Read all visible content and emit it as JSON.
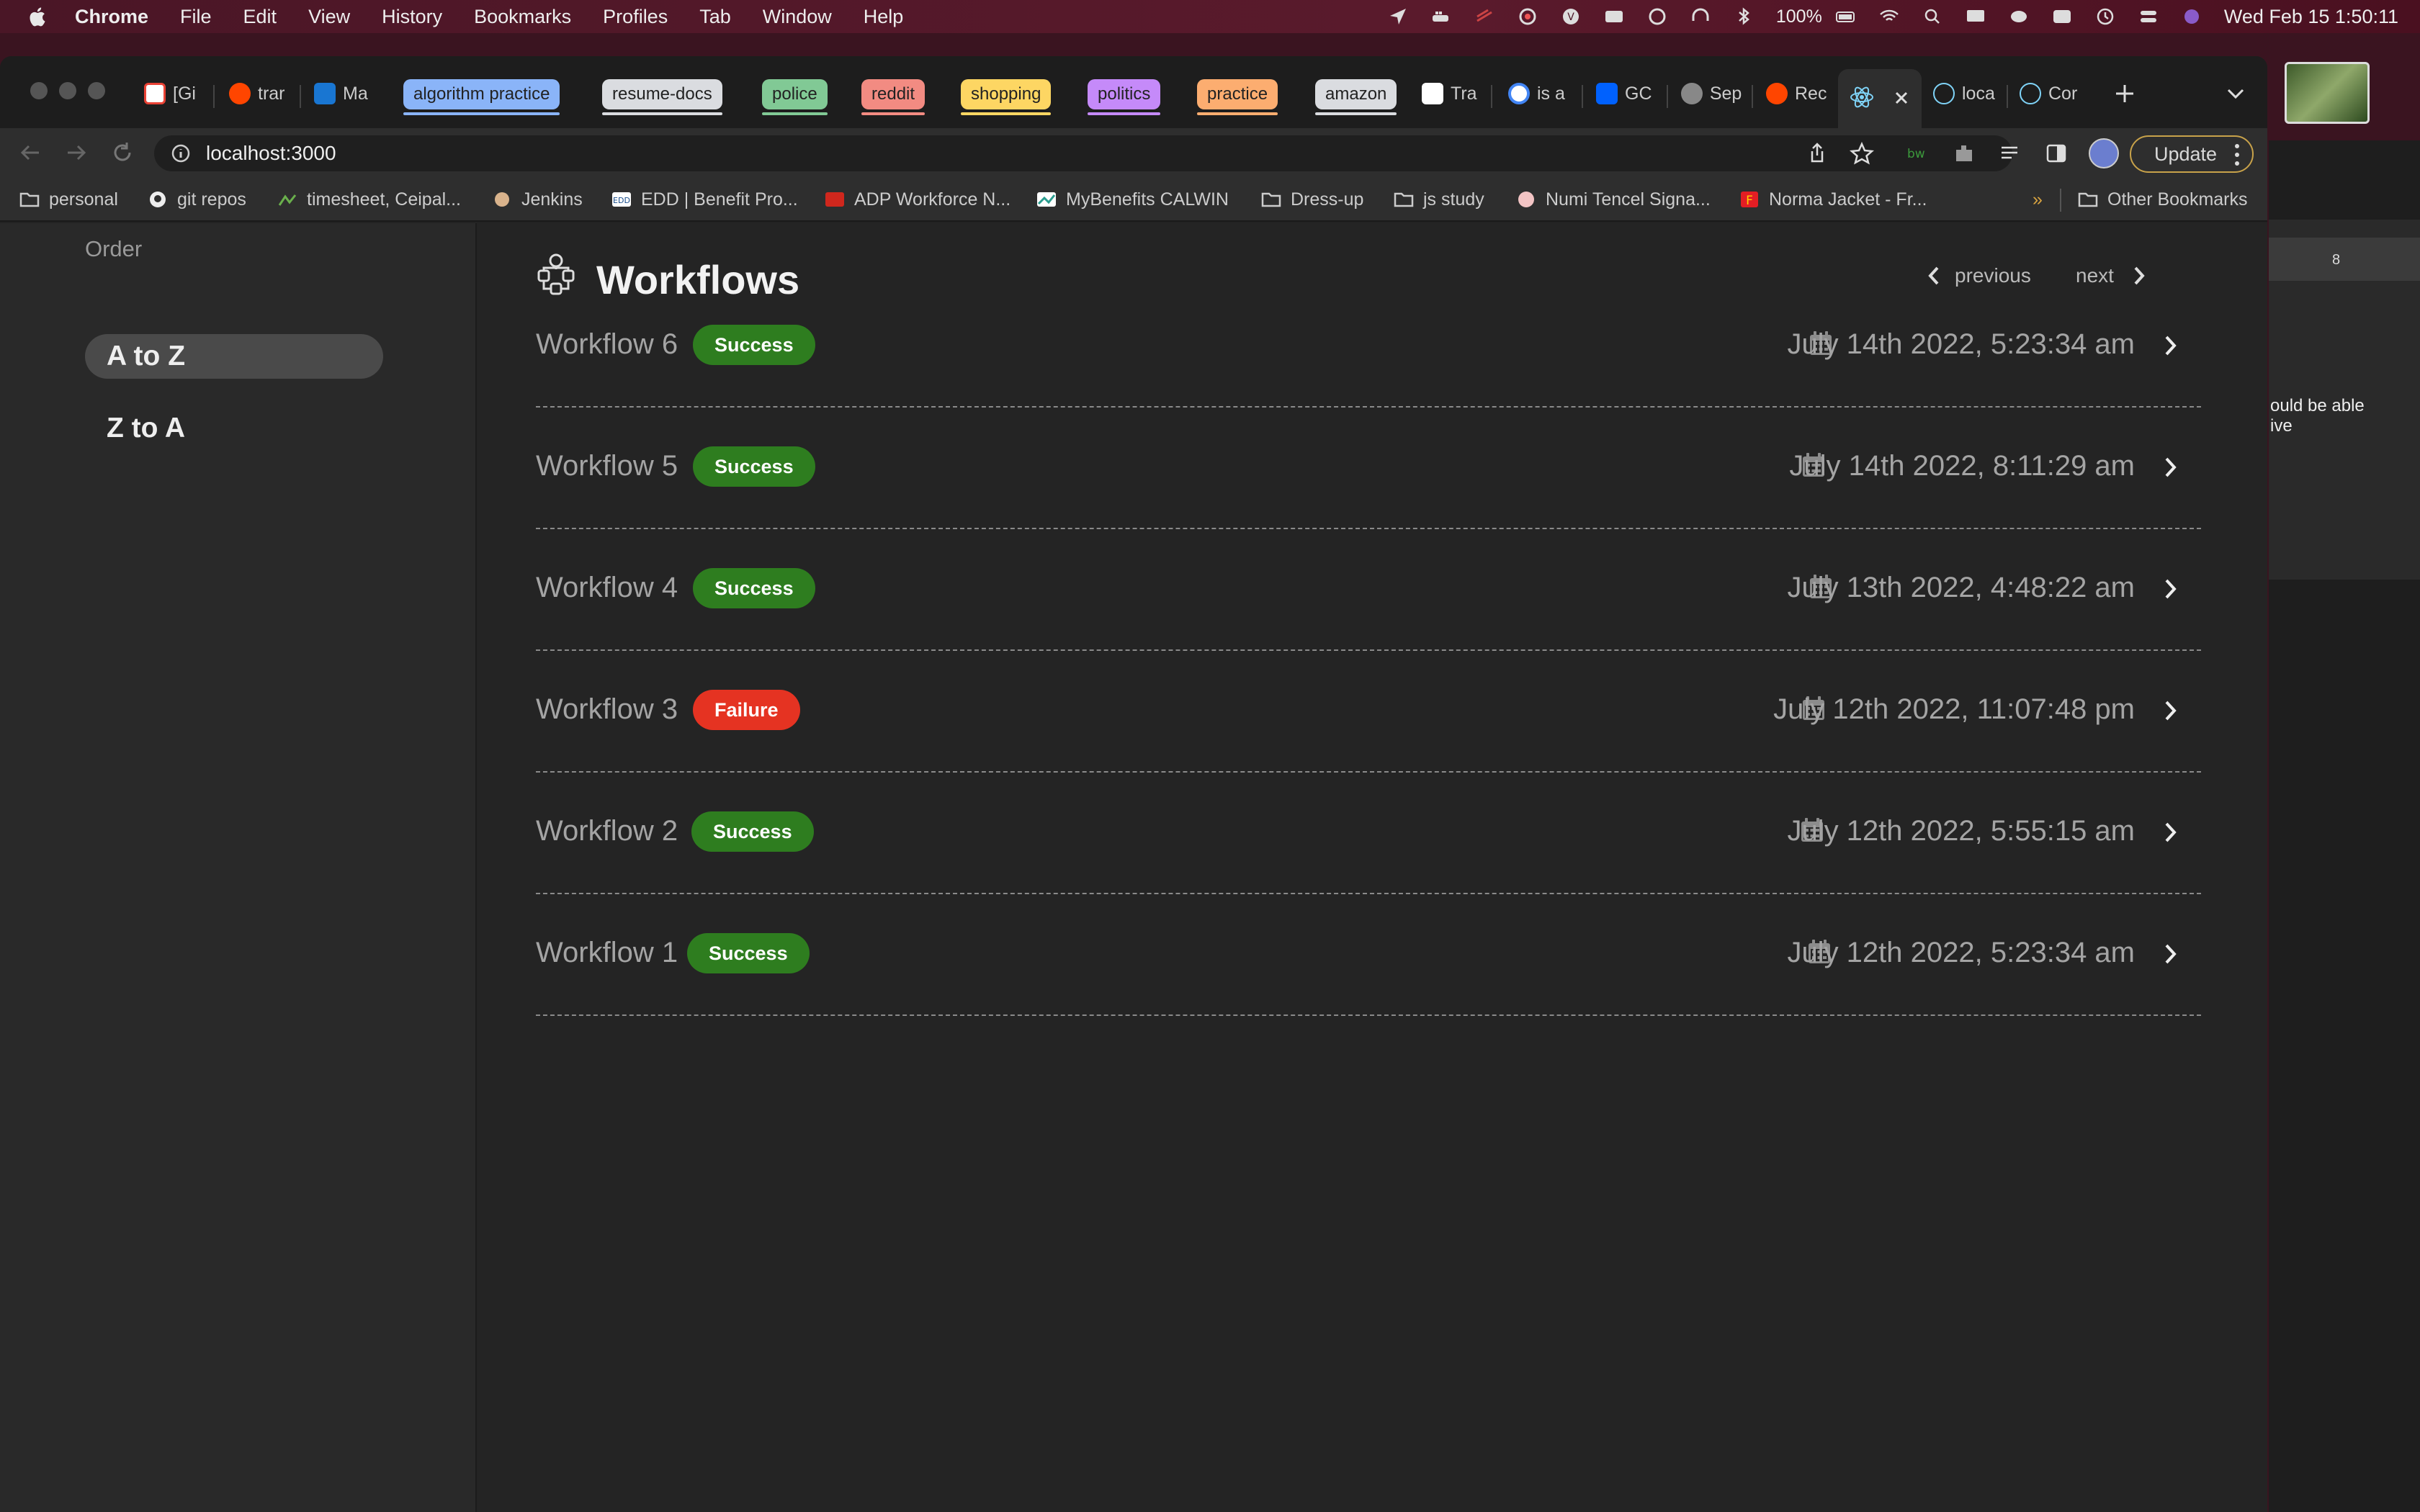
{
  "menubar": {
    "app": "Chrome",
    "items": [
      "File",
      "Edit",
      "View",
      "History",
      "Bookmarks",
      "Profiles",
      "Tab",
      "Window",
      "Help"
    ],
    "battery": "100%",
    "clock": "Wed Feb 15  1:50:11"
  },
  "tabs": {
    "leading": [
      {
        "label": "[Gi",
        "favicon": "gmail-icon",
        "color": "#e94235"
      },
      {
        "label": "trar",
        "favicon": "reddit-icon",
        "color": "#ff4500"
      },
      {
        "label": "Ma",
        "favicon": "outlook-icon",
        "color": "#1976d2"
      }
    ],
    "groups": [
      {
        "label": "algorithm practice",
        "color": "#8ab4f8"
      },
      {
        "label": "resume-docs",
        "color": "#dadce0"
      },
      {
        "label": "police",
        "color": "#81c995"
      },
      {
        "label": "reddit",
        "color": "#f28b82"
      },
      {
        "label": "shopping",
        "color": "#fdd663"
      },
      {
        "label": "politics",
        "color": "#c58af9"
      },
      {
        "label": "practice",
        "color": "#fcad70"
      },
      {
        "label": "amazon",
        "color": "#dadce0"
      }
    ],
    "trailing": [
      {
        "label": "Tra",
        "favicon": "amazon-icon"
      },
      {
        "label": "is a",
        "favicon": "google-icon"
      },
      {
        "label": "GC",
        "favicon": "dropbox-icon"
      },
      {
        "label": "Sep",
        "favicon": "ssl-icon"
      },
      {
        "label": "Rec",
        "favicon": "reddit-icon"
      },
      {
        "label": "",
        "favicon": "react-icon"
      },
      {
        "label": "loca",
        "favicon": "react-icon"
      },
      {
        "label": "Cor",
        "favicon": "react-icon"
      }
    ]
  },
  "address_bar": {
    "url": "localhost:3000"
  },
  "update_button": "Update",
  "bookmarks": [
    {
      "label": "personal",
      "icon": "folder-icon"
    },
    {
      "label": "git repos",
      "icon": "github-icon"
    },
    {
      "label": "timesheet, Ceipal...",
      "icon": "ceipal-icon"
    },
    {
      "label": "Jenkins",
      "icon": "jenkins-icon"
    },
    {
      "label": "EDD | Benefit Pro...",
      "icon": "edd-icon"
    },
    {
      "label": "ADP Workforce N...",
      "icon": "adp-icon"
    },
    {
      "label": "MyBenefits CALWIN",
      "icon": "calwin-icon"
    },
    {
      "label": "Dress-up",
      "icon": "folder-icon"
    },
    {
      "label": "js study",
      "icon": "folder-icon"
    },
    {
      "label": "Numi Tencel Signa...",
      "icon": "numi-icon"
    },
    {
      "label": "Norma Jacket - Fr...",
      "icon": "f-icon"
    }
  ],
  "bookmarks_overflow": "»",
  "other_bookmarks": "Other Bookmarks",
  "background_window": {
    "text": "ould be able\nive",
    "ruler_mark": "8"
  },
  "sidebar": {
    "order_label": "Order",
    "options": [
      {
        "label": "A to Z",
        "active": true
      },
      {
        "label": "Z to A",
        "active": false
      }
    ]
  },
  "main": {
    "title": "Workflows",
    "previous": "previous",
    "next": "next",
    "workflows": [
      {
        "name": "Workflow 6",
        "status": "Success",
        "date": "July 14th 2022, 5:23:34 am"
      },
      {
        "name": "Workflow 5",
        "status": "Success",
        "date": "July 14th 2022, 8:11:29 am"
      },
      {
        "name": "Workflow 4",
        "status": "Success",
        "date": "July 13th 2022, 4:48:22 am"
      },
      {
        "name": "Workflow 3",
        "status": "Failure",
        "date": "July 12th 2022, 11:07:48 pm"
      },
      {
        "name": "Workflow 2",
        "status": "Success",
        "date": "July 12th 2022, 5:55:15 am"
      },
      {
        "name": "Workflow 1",
        "status": "Success",
        "date": "July 12th 2022, 5:23:34 am"
      }
    ]
  },
  "colors": {
    "success": "#2e7d1f",
    "failure": "#e53322"
  }
}
